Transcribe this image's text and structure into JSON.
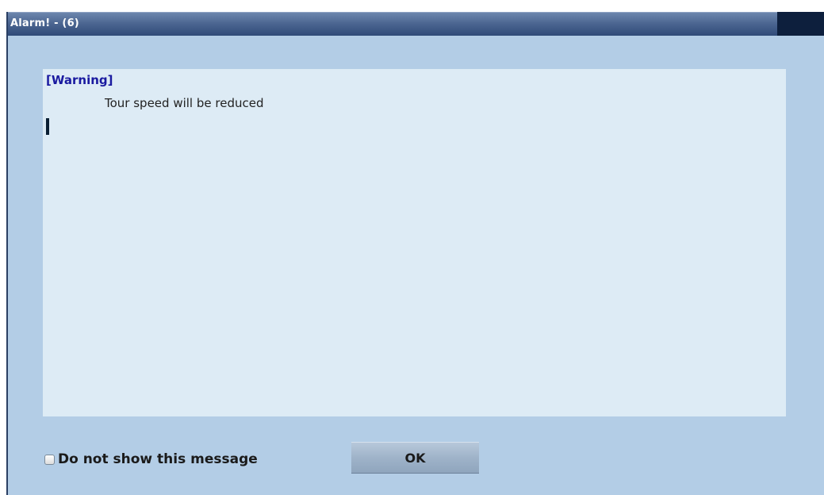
{
  "window": {
    "title": "Alarm! - (6)"
  },
  "message": {
    "severity": "[Warning]",
    "text": "Tour speed will be reduced"
  },
  "footer": {
    "checkbox_label": "Do not show this message",
    "checkbox_checked": false,
    "ok_label": "OK"
  },
  "colors": {
    "window_background": "#b3cde6",
    "message_background": "#ddebf5",
    "severity_text": "#1a1aa0",
    "titlebar": "#4d6792"
  }
}
